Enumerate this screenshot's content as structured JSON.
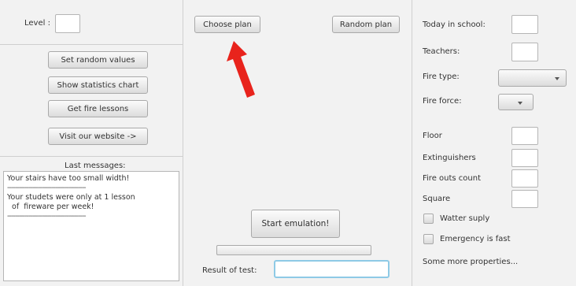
{
  "left": {
    "level_label": "Level :",
    "level_value": "",
    "buttons": [
      "Set random  values",
      "Show statistics chart",
      "Get fire lessons",
      "Visit our website ->"
    ],
    "messages_title": "Last messages:",
    "messages": [
      {
        "text": "Your stairs have too small width!"
      },
      {
        "text": "-----------------------------------------"
      },
      {
        "text": "Your studets were only at 1 lesson"
      },
      {
        "text": "  of  fireware per week!"
      },
      {
        "text": "-----------------------------------------"
      }
    ]
  },
  "center": {
    "choose_plan": "Choose plan",
    "random_plan": "Random plan",
    "start_emulation": "Start emulation!",
    "progress": 0,
    "result_label": "Result of test:",
    "result_value": ""
  },
  "right": {
    "today_in_school_label": "Today in school:",
    "teachers_label": "Teachers:",
    "fire_type_label": "Fire type:",
    "fire_force_label": "Fire force:",
    "floor_label": "Floor",
    "extinguishers_label": "Extinguishers",
    "fire_outs_label": "Fire outs count",
    "square_label": "Square",
    "water_supply_label": "Watter suply",
    "emergency_label": "Emergency is fast",
    "more_properties": "Some more properties..."
  },
  "colors": {
    "arrow": "#e8231c",
    "focus": "#8ecae6"
  }
}
